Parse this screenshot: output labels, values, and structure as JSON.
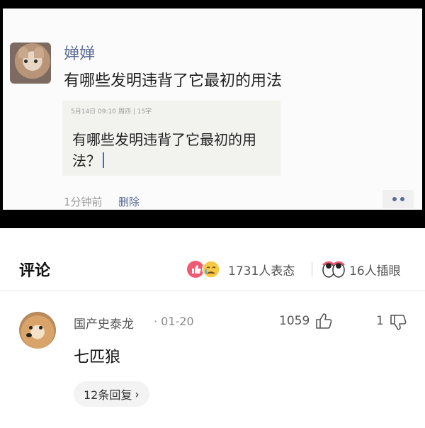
{
  "post": {
    "username": "婵婵",
    "text": "有哪些发明违背了它最初的用法",
    "quote_meta": "5月14日 09:10 周四 | 15字",
    "quote_text": "有哪些发明违背了它最初的用法？",
    "time": "1分钟前",
    "delete_label": "删除"
  },
  "comments": {
    "title": "评论",
    "reactions": "1731人表态",
    "eye_roll": "16人插眼",
    "items": [
      {
        "author": "国产史泰龙",
        "date": "· 01-20",
        "likes": "1059",
        "dislikes": "1",
        "text": "七匹狼",
        "replies": "12条回复"
      }
    ]
  },
  "colors": {
    "name_blue": "#5b6b92",
    "reaction_red": "#f05a72",
    "reaction_yellow": "#f7c843"
  }
}
